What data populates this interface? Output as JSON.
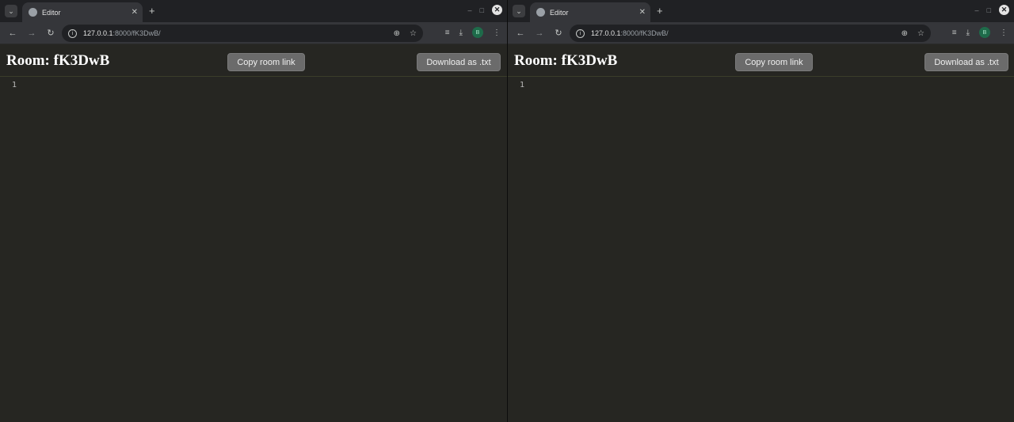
{
  "windows": [
    {
      "tab": {
        "title": "Editor",
        "close": "✕"
      },
      "new_tab": "+",
      "controls": {
        "minimize": "–",
        "maximize": "□",
        "close": "✕"
      },
      "address": {
        "host": "127.0.0.1",
        "path": ":8000/fK3DwB/"
      },
      "profile_initial": "B",
      "page": {
        "room_title": "Room: fK3DwB",
        "copy_button": "Copy room link",
        "download_button": "Download as .txt",
        "line_number": "1"
      }
    },
    {
      "tab": {
        "title": "Editor",
        "close": "✕"
      },
      "new_tab": "+",
      "controls": {
        "minimize": "–",
        "maximize": "□",
        "close": "✕"
      },
      "address": {
        "host": "127.0.0.1",
        "path": ":8000/fK3DwB/"
      },
      "profile_initial": "B",
      "page": {
        "room_title": "Room: fK3DwB",
        "copy_button": "Copy room link",
        "download_button": "Download as .txt",
        "line_number": "1"
      }
    }
  ],
  "icons": {
    "tab_search": "chevron-down-icon",
    "favicon": "globe-icon",
    "back": "back-arrow-icon",
    "forward": "forward-arrow-icon",
    "reload": "reload-icon",
    "site_info": "info-icon",
    "zoom": "zoom-icon",
    "bookmark": "star-icon",
    "media": "media-control-icon",
    "downloads": "download-icon",
    "menu": "kebab-menu-icon"
  },
  "colors": {
    "page_background": "#262622",
    "button_background": "#6b6b6b",
    "title_text": "#ffffff",
    "profile_badge": "#1e6b4a"
  }
}
